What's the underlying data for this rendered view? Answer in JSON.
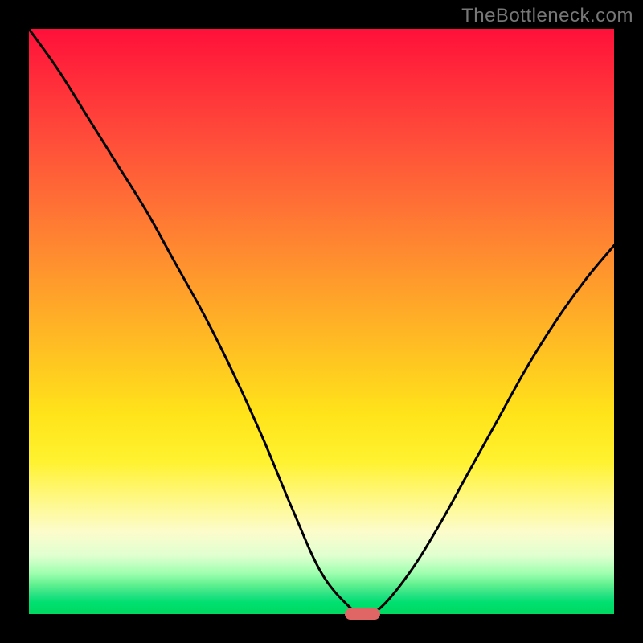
{
  "watermark": "TheBottleneck.com",
  "colors": {
    "frame": "#000000",
    "curve": "#000000",
    "marker": "#e06666",
    "gradient_top": "#ff103a",
    "gradient_bottom": "#00d860"
  },
  "chart_data": {
    "type": "line",
    "title": "",
    "xlabel": "",
    "ylabel": "",
    "xlim": [
      0,
      100
    ],
    "ylim": [
      0,
      100
    ],
    "x": [
      0,
      5,
      10,
      15,
      20,
      25,
      30,
      35,
      40,
      45,
      50,
      55,
      57,
      60,
      65,
      70,
      75,
      80,
      85,
      90,
      95,
      100
    ],
    "values": [
      100,
      93,
      85,
      77,
      69,
      60,
      51,
      41,
      30,
      18,
      7,
      1,
      0,
      1,
      7,
      15,
      24,
      33,
      42,
      50,
      57,
      63
    ],
    "marker": {
      "x": 57,
      "y": 0,
      "shape": "pill"
    },
    "axes_visible": false,
    "grid": false
  }
}
